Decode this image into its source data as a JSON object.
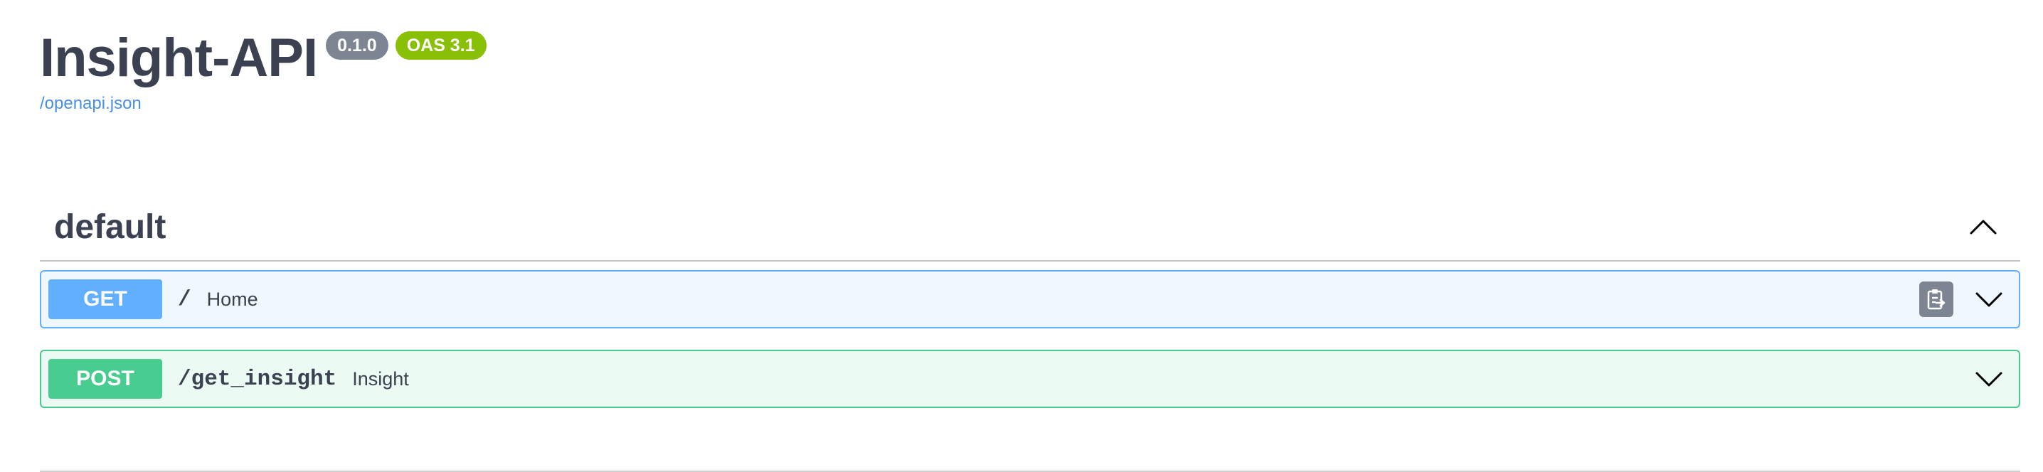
{
  "info": {
    "title": "Insight-API",
    "version_badge": "0.1.0",
    "oas_badge": "OAS 3.1",
    "spec_link": "/openapi.json"
  },
  "tag": {
    "name": "default",
    "toggle_icon": "chevron-up-icon"
  },
  "operations": [
    {
      "method": "GET",
      "path": "/",
      "summary": "Home",
      "color": "#61affe",
      "icons": [
        "copy-to-clipboard-icon",
        "chevron-down-icon"
      ]
    },
    {
      "method": "POST",
      "path": "/get_insight",
      "summary": "Insight",
      "color": "#49cc90",
      "icons": [
        "chevron-down-icon"
      ]
    }
  ],
  "colors": {
    "text": "#3b4151",
    "link": "#4990e2",
    "version_badge": "#7d8492",
    "oas_badge": "#89bf04",
    "get": "#61affe",
    "post": "#49cc90"
  }
}
